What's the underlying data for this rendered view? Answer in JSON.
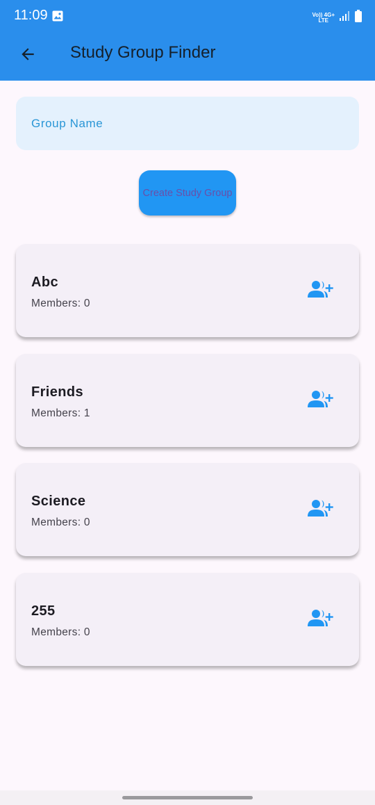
{
  "status_bar": {
    "time": "11:09",
    "network_line1": "Vo)) 4G+",
    "network_line2": "LTE",
    "icons": [
      "gallery-icon",
      "signal-icon",
      "battery-icon"
    ]
  },
  "app_bar": {
    "title": "Study Group Finder",
    "back_icon": "arrow-back-icon",
    "color": "#2a8eec"
  },
  "form": {
    "group_name_placeholder": "Group Name",
    "group_name_value": "",
    "create_button_label": "Create Study Group",
    "button_color": "#2196f3",
    "input_background": "#e4f1fd"
  },
  "groups": [
    {
      "name": "Abc",
      "members_label": "Members: ",
      "members_count": "0",
      "join_icon": "person-add-icon"
    },
    {
      "name": "Friends",
      "members_label": "Members: ",
      "members_count": "1",
      "join_icon": "person-add-icon"
    },
    {
      "name": "Science",
      "members_label": "Members: ",
      "members_count": "0",
      "join_icon": "person-add-icon"
    },
    {
      "name": "255",
      "members_label": "Members: ",
      "members_count": "0",
      "join_icon": "person-add-icon"
    }
  ],
  "colors": {
    "accent": "#2196f3",
    "card_background": "#f4eff7",
    "page_background": "#fdf7fd"
  }
}
